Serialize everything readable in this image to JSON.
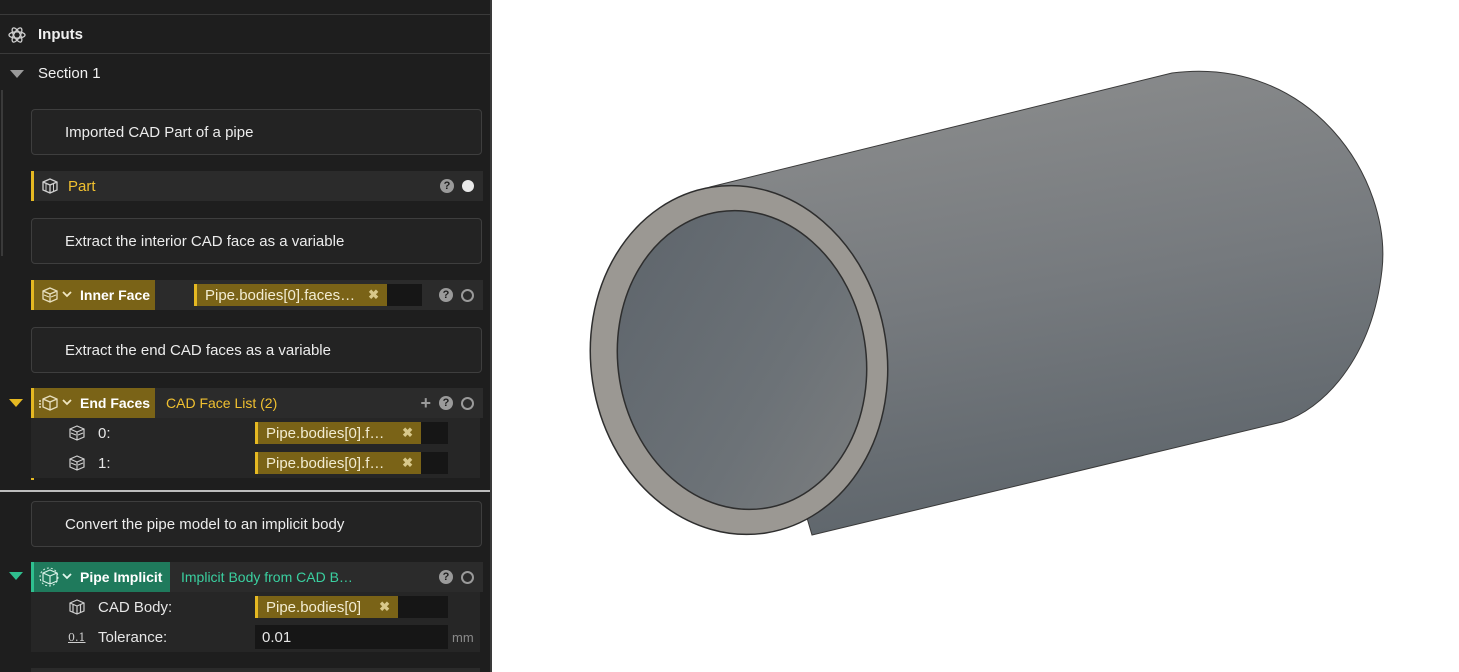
{
  "inputs": {
    "title": "Inputs"
  },
  "section": {
    "title": "Section 1"
  },
  "notes": {
    "part_note": "Imported CAD Part of a pipe",
    "inner_note": "Extract the interior CAD face as a variable",
    "end_note": "Extract the end CAD faces as a variable",
    "implicit_note": "Convert the pipe model to an implicit body"
  },
  "part": {
    "label": "Part",
    "help": "?"
  },
  "inner_face": {
    "label": "Inner Face",
    "value": "Pipe.bodies[0].faces…",
    "help": "?"
  },
  "end_faces": {
    "label": "End Faces",
    "type": "CAD Face List (2)",
    "help": "?",
    "items": [
      {
        "index": "0:",
        "value": "Pipe.bodies[0].f…"
      },
      {
        "index": "1:",
        "value": "Pipe.bodies[0].f…"
      }
    ]
  },
  "pipe_implicit": {
    "label": "Pipe Implicit",
    "type": "Implicit Body from CAD B…",
    "help": "?",
    "cad_body_label": "CAD Body:",
    "cad_body_value": "Pipe.bodies[0]",
    "tolerance_icon": "0.1",
    "tolerance_label": "Tolerance:",
    "tolerance_value": "0.01",
    "tolerance_unit": "mm"
  },
  "icons": {
    "inputs": "atom-icon",
    "part": "cad-part-icon",
    "face": "cad-face-icon",
    "implicit": "implicit-body-icon",
    "remove": "remove-x-icon",
    "add": "plus-icon"
  },
  "colors": {
    "panel_bg": "#1e1e1e",
    "gold_accent": "#e5b822",
    "gold_fill": "#7a6317",
    "teal_accent": "#2fbf8f",
    "teal_fill": "#1f7a5c",
    "pipe_outer": "#7a7d80",
    "pipe_rim": "#9a9792"
  }
}
